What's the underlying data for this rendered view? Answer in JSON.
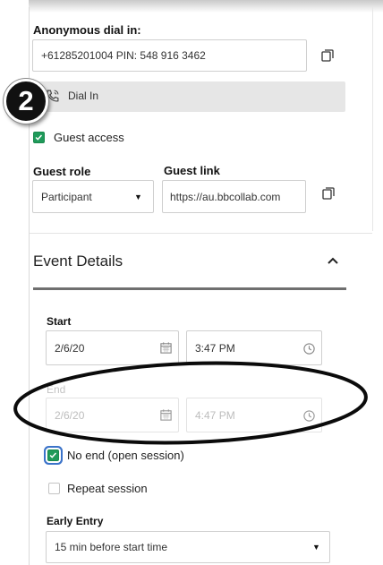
{
  "step_badge": "2",
  "dial_in": {
    "heading": "Anonymous dial in:",
    "value": "+61285201004 PIN: 548 916 3462",
    "copy_icon": "copy-icon",
    "dial_label": "Dial In",
    "dial_icon": "phone-icon"
  },
  "guest_access": {
    "label": "Guest access",
    "checked": true
  },
  "guest_role": {
    "label": "Guest role",
    "value": "Participant"
  },
  "guest_link": {
    "label": "Guest link",
    "value": "https://au.bbcollab.com"
  },
  "event_details": {
    "title": "Event Details",
    "toggle_icon": "chevron-up-icon"
  },
  "start": {
    "label": "Start",
    "date": "2/6/20",
    "time": "3:47 PM"
  },
  "end": {
    "label": "End",
    "date": "2/6/20",
    "time": "4:47 PM",
    "disabled": true
  },
  "no_end": {
    "label": "No end (open session)",
    "checked": true
  },
  "repeat": {
    "label": "Repeat session",
    "checked": false
  },
  "early_entry": {
    "label": "Early Entry",
    "value": "15 min before start time"
  },
  "colors": {
    "check_green": "#1f9a5a",
    "focus_blue": "#3b73c9",
    "row_gray": "#e6e6e6"
  }
}
